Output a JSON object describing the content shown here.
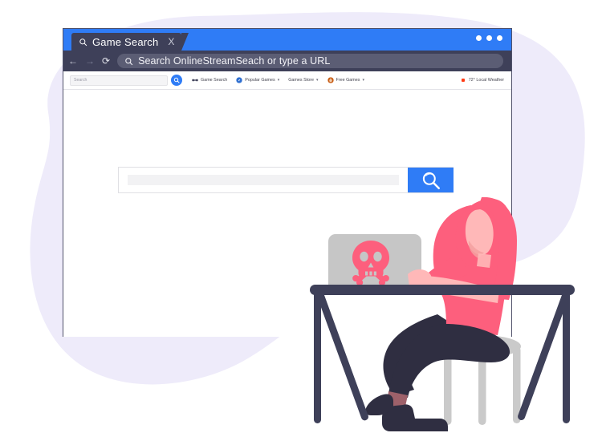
{
  "theme": {
    "accent_blue": "#2f7cf6",
    "dark_navy": "#3e4059",
    "blob_lavender": "#eeebfa",
    "skin_pink": "#ffb8b8",
    "garment_pink": "#fd5f7d",
    "laptop_gray": "#c6c6c6",
    "trousers_navy": "#2f2e41",
    "shoe_navy": "#2f2e41",
    "stool_gray": "#cacaca",
    "alert_orange": "#ff3b14"
  },
  "browser": {
    "tab": {
      "title": "Game Search",
      "search_icon": "search-icon",
      "close_label": "X"
    },
    "window_controls": {
      "dots": 3
    },
    "nav": {
      "back": "←",
      "forward": "→",
      "reload": "⟳"
    },
    "omnibox": {
      "icon": "search-icon",
      "value": "Search OnlineStreamSeach or type a URL"
    }
  },
  "site_toolbar": {
    "search": {
      "placeholder": "Search",
      "go_icon": "search-icon"
    },
    "menu_items": [
      {
        "label": "Game Search",
        "icon": "binoculars-icon",
        "icon_color": "#3e4059",
        "has_caret": false
      },
      {
        "label": "Popular Games",
        "icon": "compass-icon",
        "icon_color": "#2f6fd0",
        "has_caret": true
      },
      {
        "label": "Games Store",
        "icon": "none",
        "icon_color": "#3e4059",
        "has_caret": true
      },
      {
        "label": "Free Games",
        "icon": "joystick-icon",
        "icon_color": "#c75b12",
        "has_caret": true
      }
    ],
    "weather": {
      "indicator": "alert-dot",
      "label": "72° Local Weather"
    }
  },
  "page": {
    "search_box": {
      "value": "",
      "placeholder": "",
      "button_icon": "search-icon"
    }
  },
  "illustration": {
    "name": "woman-at-desk-with-infected-laptop",
    "laptop_screen_icon": "skull-and-crossbones-icon",
    "elements": [
      "background-blob",
      "desk",
      "laptop",
      "stool",
      "person"
    ]
  }
}
